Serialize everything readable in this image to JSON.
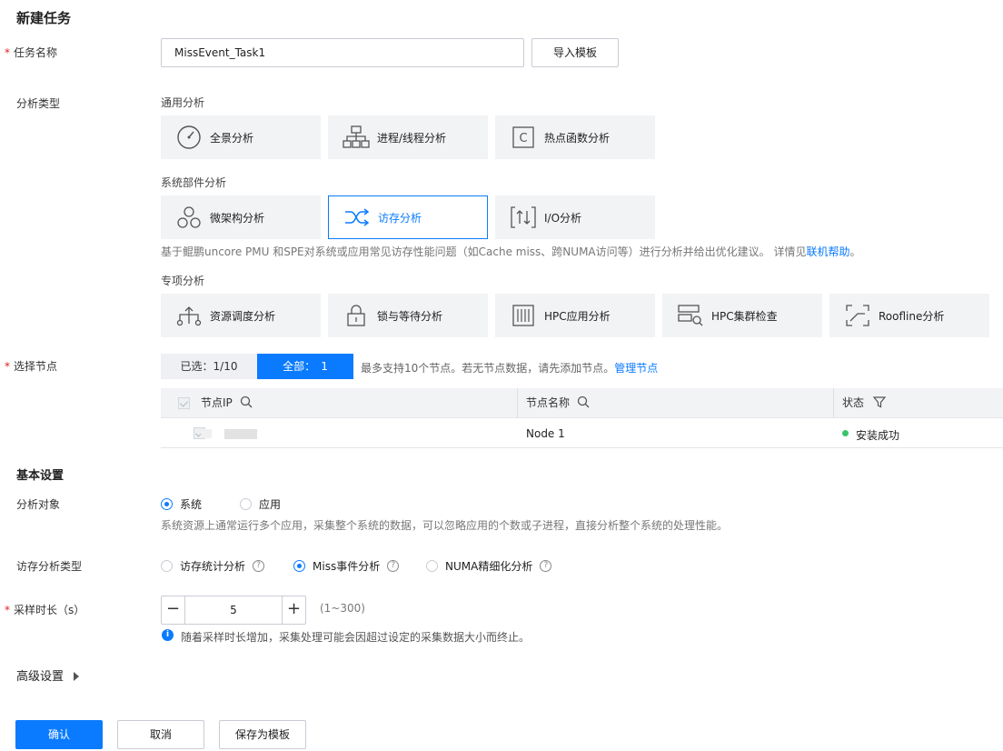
{
  "page_title": "新建任务",
  "task_name": {
    "label": "任务名称",
    "value": "MissEvent_Task1",
    "import_button": "导入模板"
  },
  "analysis_type": {
    "label": "分析类型",
    "general": {
      "title": "通用分析",
      "items": [
        "全景分析",
        "进程/线程分析",
        "热点函数分析"
      ]
    },
    "system": {
      "title": "系统部件分析",
      "items": [
        "微架构分析",
        "访存分析",
        "I/O分析"
      ],
      "selected": "访存分析"
    },
    "hint": "基于鲲鹏uncore PMU 和SPE对系统或应用常见访存性能问题（如Cache miss、跨NUMA访问等）进行分析并给出优化建议。 详情见",
    "hint_link": "联机帮助",
    "hint_end": "。",
    "special": {
      "title": "专项分析",
      "items": [
        "资源调度分析",
        "锁与等待分析",
        "HPC应用分析",
        "HPC集群检查",
        "Roofline分析"
      ]
    }
  },
  "node_select": {
    "label": "选择节点",
    "selected_tab": "已选：1/10",
    "all_tab": "全部：",
    "all_count": "1",
    "hint": "最多支持10个节点。若无节点数据，请先添加节点。",
    "hint_link": "管理节点",
    "columns": [
      "节点IP",
      "节点名称",
      "状态"
    ],
    "rows": [
      {
        "ip": "",
        "name": "Node 1",
        "status": "安装成功"
      }
    ],
    "status_color": "#3cc46a"
  },
  "basic_settings": {
    "title": "基本设置",
    "analysis_object": {
      "label": "分析对象",
      "options": [
        "系统",
        "应用"
      ],
      "selected": "系统",
      "hint": "系统资源上通常运行多个应用，采集整个系统的数据，可以忽略应用的个数或子进程，直接分析整个系统的处理性能。"
    },
    "mem_type": {
      "label": "访存分析类型",
      "options": [
        "访存统计分析",
        "Miss事件分析",
        "NUMA精细化分析"
      ],
      "selected": "Miss事件分析"
    },
    "sample_time": {
      "label": "采样时长（s）",
      "value": "5",
      "range": "(1~300)",
      "hint": "随着采样时长增加，采集处理可能会因超过设定的采集数据大小而终止。"
    }
  },
  "advanced": {
    "title": "高级设置"
  },
  "footer": {
    "confirm": "确认",
    "cancel": "取消",
    "save_template": "保存为模板"
  },
  "colors": {
    "accent": "#0a7bff",
    "required": "#e32020"
  }
}
